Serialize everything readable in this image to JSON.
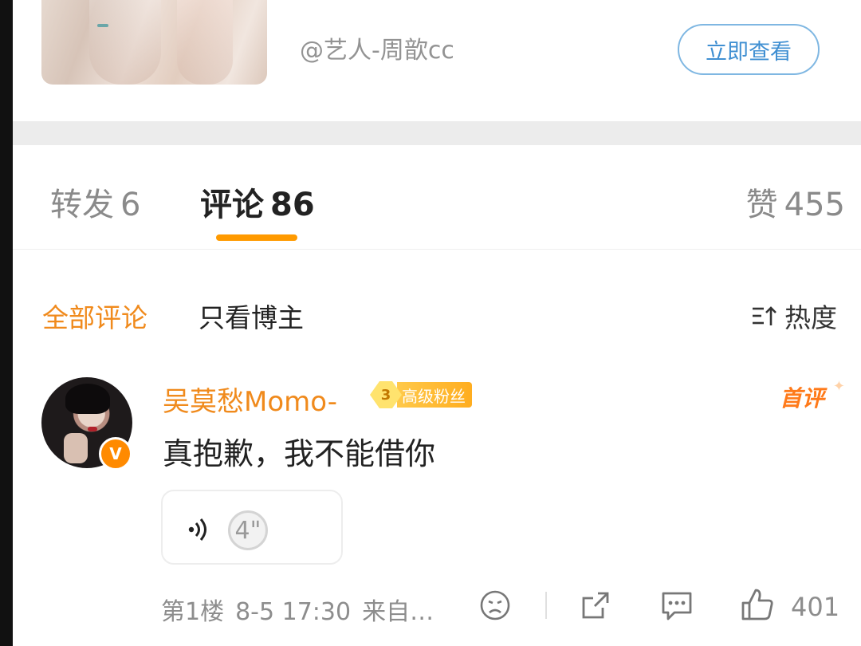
{
  "card": {
    "author": "@艺人-周歆cc",
    "view_button": "立即查看"
  },
  "tabs": {
    "repost_label": "转发",
    "repost_count": "6",
    "comment_label": "评论",
    "comment_count": "86",
    "like_label": "赞",
    "like_count": "455"
  },
  "filters": {
    "all": "全部评论",
    "host_only": "只看博主",
    "sort": "热度"
  },
  "comment": {
    "username": "吴莫愁Momo-",
    "fan_level": "3",
    "fan_label": "高级粉丝",
    "first_tag": "首评",
    "text": "真抱歉，我不能借你",
    "voice_duration": "4\"",
    "floor": "第1楼",
    "time": "8-5 17:30",
    "source": "来自…",
    "like_count": "401",
    "verified_mark": "V"
  },
  "colors": {
    "accent_orange": "#f08a1c",
    "tab_underline": "#ff9a00",
    "button_blue": "#3f8fd2"
  },
  "icons": [
    "sort-icon",
    "voice-icon",
    "dislike-icon",
    "share-icon",
    "reply-icon",
    "like-icon",
    "verified-icon"
  ]
}
